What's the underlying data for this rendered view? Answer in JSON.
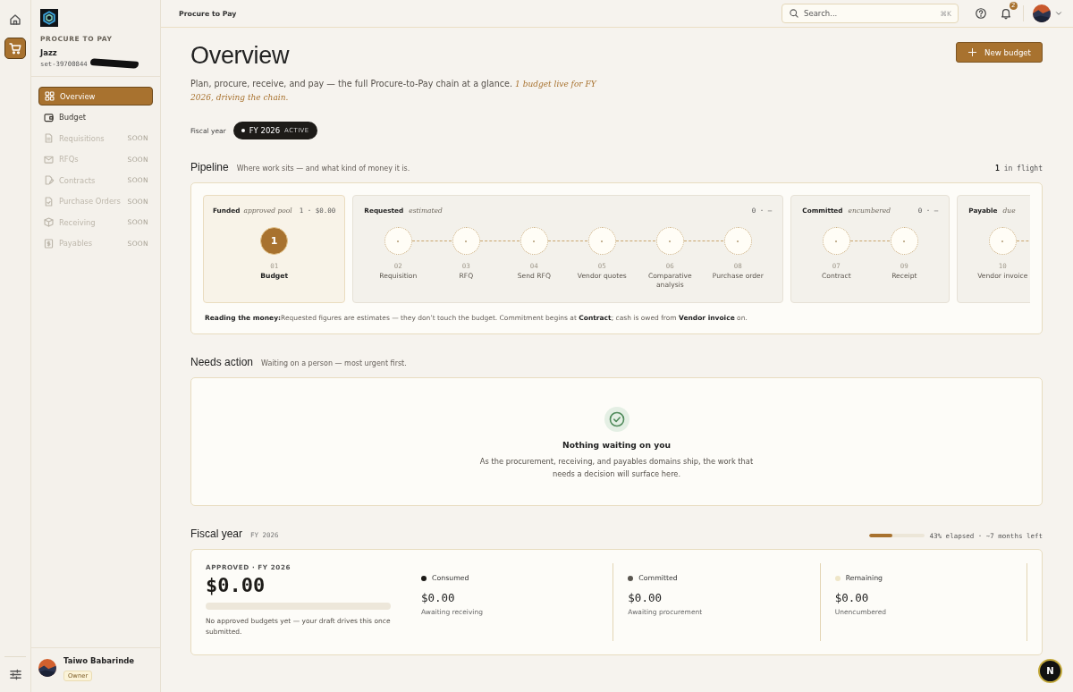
{
  "rail": [
    {
      "selected": false
    },
    {
      "selected": true
    }
  ],
  "sidebar": {
    "section": "PROCURE TO PAY",
    "org_name": "Jazz",
    "org_id": "set-39700844",
    "items": [
      {
        "label": "Overview",
        "selected": true,
        "disabled": false
      },
      {
        "label": "Budget",
        "selected": false,
        "disabled": false
      },
      {
        "label": "Requisitions",
        "selected": false,
        "disabled": true,
        "badge": "SOON"
      },
      {
        "label": "RFQs",
        "selected": false,
        "disabled": true,
        "badge": "SOON"
      },
      {
        "label": "Contracts",
        "selected": false,
        "disabled": true,
        "badge": "SOON"
      },
      {
        "label": "Purchase Orders",
        "selected": false,
        "disabled": true,
        "badge": "SOON"
      },
      {
        "label": "Receiving",
        "selected": false,
        "disabled": true,
        "badge": "SOON"
      },
      {
        "label": "Payables",
        "selected": false,
        "disabled": true,
        "badge": "SOON"
      }
    ],
    "user": {
      "name": "Taiwo Babarinde",
      "role": "Owner"
    }
  },
  "topbar": {
    "breadcrumb": "Procure to Pay",
    "search": {
      "placeholder": "Search...",
      "shortcut": "⌘K"
    },
    "notifications": "2"
  },
  "header": {
    "title": "Overview",
    "subtitle": "Plan, procure, receive, and pay — the full Procure-to-Pay chain at a glance. ",
    "highlight": "1 budget live for FY 2026, driving the chain.",
    "button": "New budget"
  },
  "fiscal_filter": {
    "label": "Fiscal year",
    "chip": "FY 2026",
    "chip_status": "ACTIVE"
  },
  "pipeline": {
    "title": "Pipeline",
    "subtitle": "Where work sits — and what kind of money it is.",
    "count": "1",
    "count_label": "in flight",
    "stages": [
      {
        "kind": "funded",
        "name": "Funded",
        "tag": "approved pool",
        "summary": "1 · $0.00",
        "truncated": false,
        "steps": [
          {
            "number": "01",
            "label": "Budget",
            "filled": true,
            "count": "1"
          }
        ]
      },
      {
        "kind": "plain",
        "name": "Requested",
        "tag": "estimated",
        "summary": "0 · –",
        "truncated": false,
        "steps": [
          {
            "number": "02",
            "label": "Requisition",
            "filled": false
          },
          {
            "number": "03",
            "label": "RFQ",
            "filled": false
          },
          {
            "number": "04",
            "label": "Send RFQ",
            "filled": false
          },
          {
            "number": "05",
            "label": "Vendor quotes",
            "filled": false
          },
          {
            "number": "06",
            "label": "Comparative analysis",
            "filled": false
          },
          {
            "number": "08",
            "label": "Purchase order",
            "filled": false
          }
        ]
      },
      {
        "kind": "plain",
        "name": "Committed",
        "tag": "encumbered",
        "summary": "0 · –",
        "truncated": false,
        "steps": [
          {
            "number": "07",
            "label": "Contract",
            "filled": false
          },
          {
            "number": "09",
            "label": "Receipt",
            "filled": false
          }
        ]
      },
      {
        "kind": "plain",
        "name": "Payable",
        "tag": "due",
        "truncated": true,
        "steps": [
          {
            "number": "10",
            "label": "Vendor invoice",
            "filled": false
          }
        ]
      }
    ],
    "note": "**Reading the money:**Requested figures are estimates — they don’t touch the budget. Commitment begins at **Contract**; cash is owed from **Vendor invoice** on."
  },
  "needs_action": {
    "title": "Needs action",
    "subtitle": "Waiting on a person — most urgent first.",
    "empty_title": "Nothing waiting on you",
    "empty_text": "As the procurement, receiving, and payables domains ship, the work that needs a decision will surface here."
  },
  "fiscal_year": {
    "title": "Fiscal year",
    "tag": "FY 2026",
    "level": 0.43,
    "progress_text": "43% elapsed · ~7 months left",
    "approved_label": "APPROVED · FY 2026",
    "approved_amount": "$0.00",
    "approved_note": "No approved budgets yet — your draft drives this once submitted.",
    "metrics": [
      {
        "label": "Consumed",
        "color": "#1c1a17",
        "amount": "$0.00",
        "note": "Awaiting receiving"
      },
      {
        "label": "Committed",
        "color": "#5a5650",
        "amount": "$0.00",
        "note": "Awaiting procurement"
      },
      {
        "label": "Remaining",
        "color": "#efe6c8",
        "amount": "$0.00",
        "note": "Unencumbered"
      }
    ]
  },
  "dev_badge": "N"
}
